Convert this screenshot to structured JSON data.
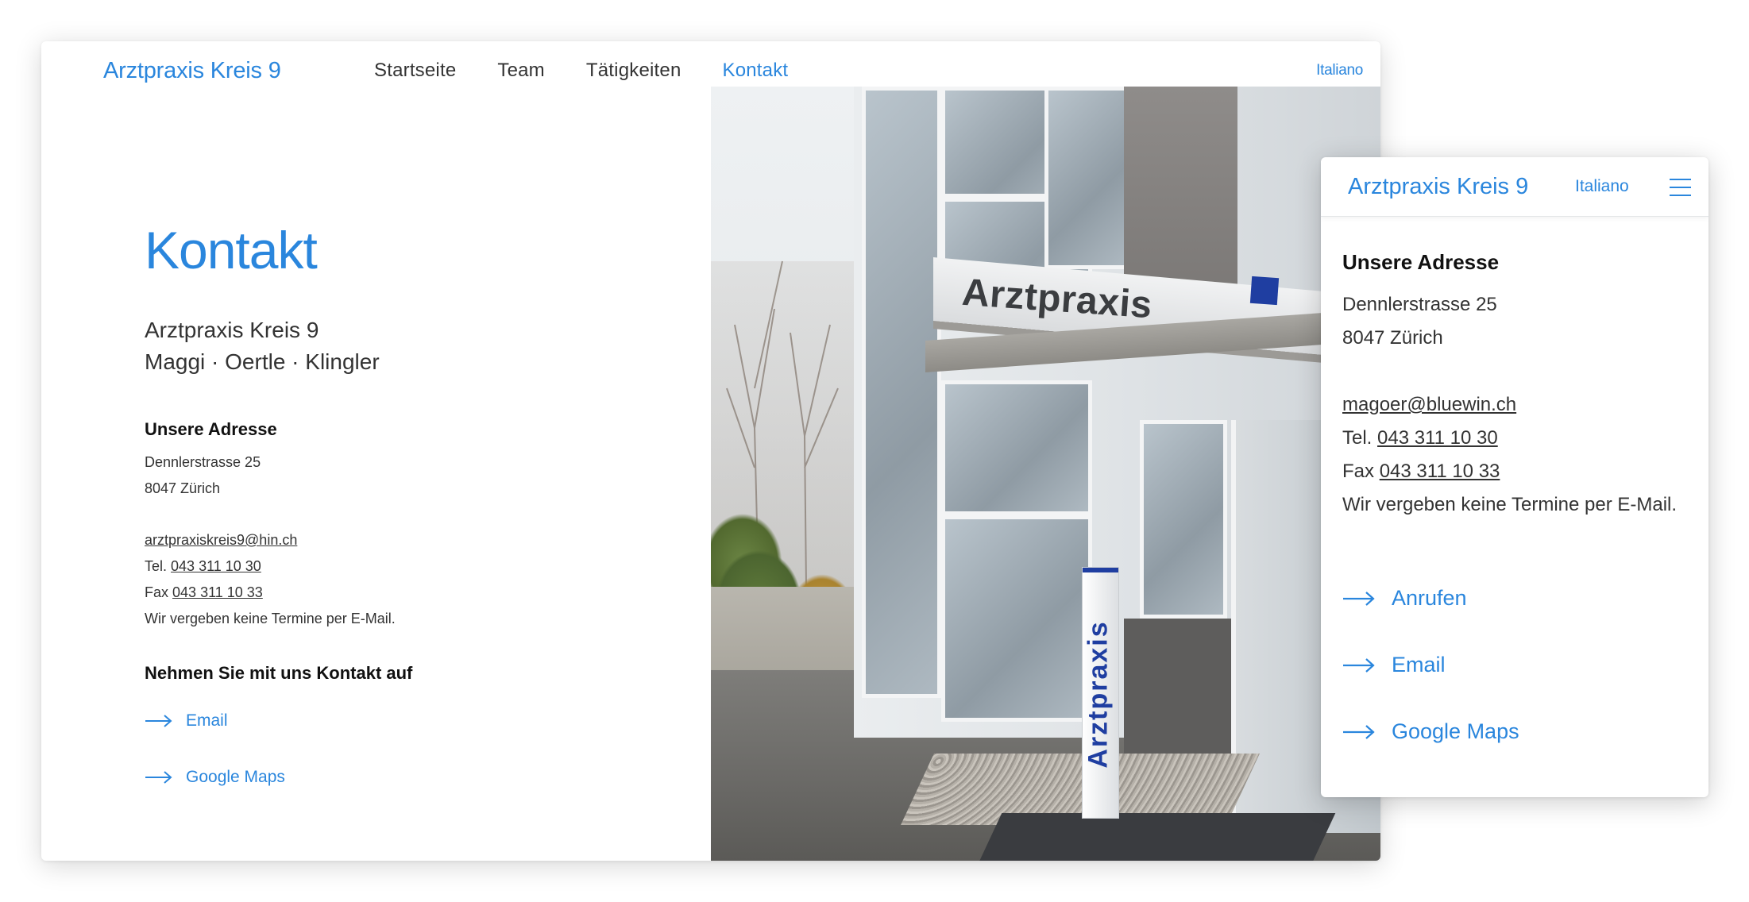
{
  "desktop": {
    "logo": "Arztpraxis Kreis 9",
    "nav": [
      "Startseite",
      "Team",
      "Tätigkeiten",
      "Kontakt"
    ],
    "active_nav": "Kontakt",
    "language": "Italiano",
    "title": "Kontakt",
    "subtitle_line1": "Arztpraxis Kreis 9",
    "subtitle_line2": "Maggi · Oertle · Klingler",
    "address_heading": "Unsere Adresse",
    "street": "Dennlerstrasse 25",
    "city": "8047 Zürich",
    "email": "arztpraxiskreis9@hin.ch",
    "tel_label": "Tel.",
    "tel": "043 311 10 30",
    "fax_label": "Fax",
    "fax": "043 311 10 33",
    "note": "Wir vergeben keine Termine per E-Mail.",
    "contact_heading": "Nehmen Sie mit uns Kontakt auf",
    "links": [
      "Email",
      "Google Maps"
    ]
  },
  "photo": {
    "canopy_sign": "Arztpraxis",
    "pylon_sign": "Arztpraxis"
  },
  "mobile": {
    "logo": "Arztpraxis Kreis 9",
    "language": "Italiano",
    "address_heading": "Unsere Adresse",
    "street": "Dennlerstrasse 25",
    "city": "8047 Zürich",
    "email": "magoer@bluewin.ch",
    "tel_label": "Tel.",
    "tel": "043 311 10 30",
    "fax_label": "Fax",
    "fax": "043 311 10 33",
    "note": "Wir vergeben keine Termine per E-Mail.",
    "links": [
      "Anrufen",
      "Email",
      "Google Maps"
    ]
  },
  "icons": {
    "link_arrow": "arrow-right-icon",
    "menu": "hamburger-menu-icon"
  },
  "colors": {
    "accent": "#2a86dd",
    "sign_blue": "#1f3ea1"
  }
}
